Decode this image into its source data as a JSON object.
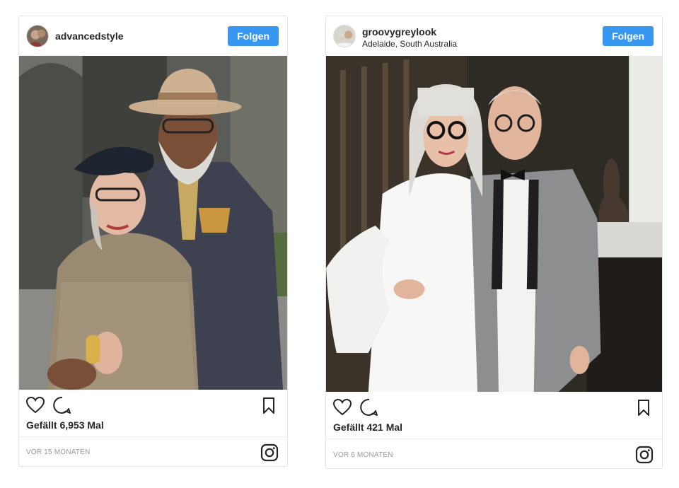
{
  "posts": [
    {
      "username": "advancedstyle",
      "location": "",
      "follow_label": "Folgen",
      "likes_text": "Gefällt 6,953 Mal",
      "time_text": "VOR 15 MONATEN",
      "icons": {
        "like": "heart-icon",
        "comment": "comment-icon",
        "save": "bookmark-icon",
        "brand": "instagram-icon"
      }
    },
    {
      "username": "groovygreylook",
      "location": "Adelaide, South Australia",
      "follow_label": "Folgen",
      "likes_text": "Gefällt 421 Mal",
      "time_text": "VOR 6 MONATEN",
      "icons": {
        "like": "heart-icon",
        "comment": "comment-icon",
        "save": "bookmark-icon",
        "brand": "instagram-icon"
      }
    }
  ],
  "colors": {
    "follow_button": "#3897f0",
    "text": "#262626",
    "muted": "#999999",
    "border": "#e3e3e3"
  }
}
